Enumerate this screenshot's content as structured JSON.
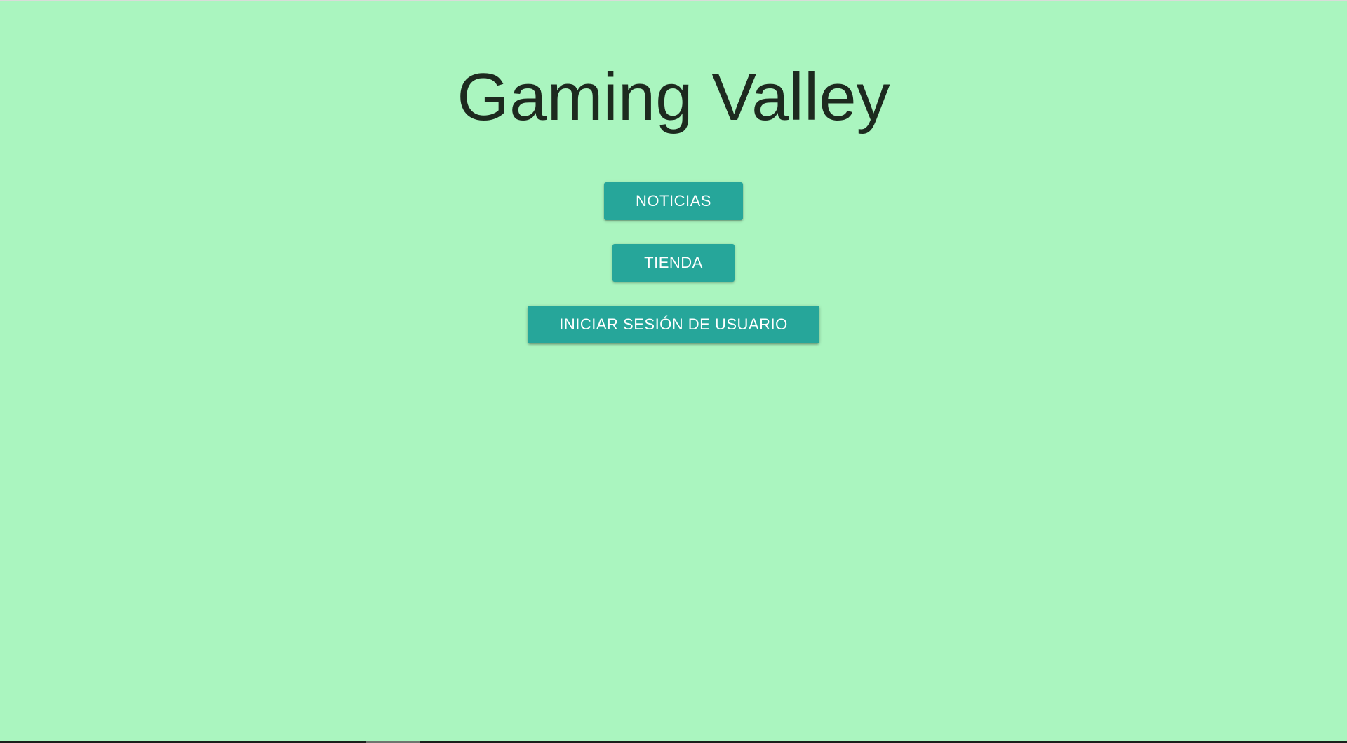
{
  "page": {
    "title": "Gaming Valley"
  },
  "menu": {
    "items": [
      {
        "label": "NOTICIAS"
      },
      {
        "label": "TIENDA"
      },
      {
        "label": "INICIAR SESIÓN DE USUARIO"
      }
    ]
  },
  "colors": {
    "background": "#aaf5bf",
    "button": "#26a69a",
    "button_text": "#ffffff",
    "title_text": "#1d2a1f"
  }
}
